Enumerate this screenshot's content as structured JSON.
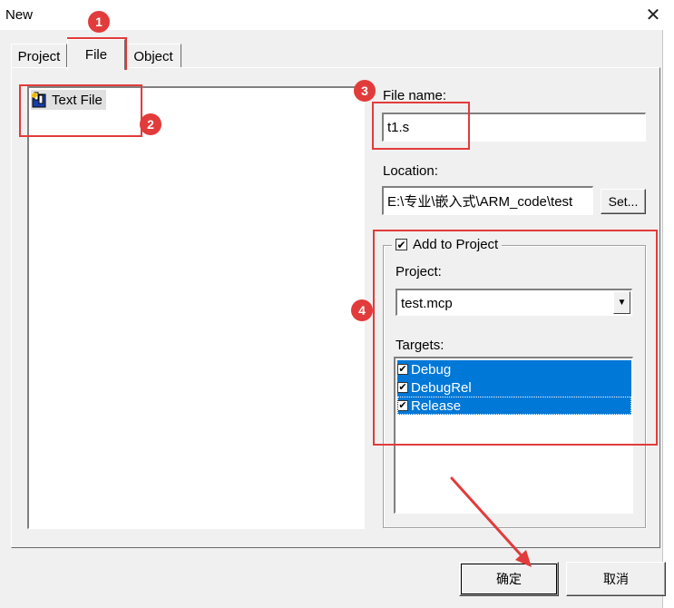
{
  "window": {
    "title": "New",
    "close_glyph": "✕"
  },
  "tabs": [
    {
      "label": "Project"
    },
    {
      "label": "File",
      "active": true
    },
    {
      "label": "Object"
    }
  ],
  "file_types": [
    {
      "label": "Text File",
      "icon": "text-file-icon"
    }
  ],
  "file_name": {
    "label": "File name:",
    "value": "t1.s"
  },
  "location": {
    "label": "Location:",
    "value": "E:\\专业\\嵌入式\\ARM_code\\test",
    "set_button": "Set..."
  },
  "add_to_project": {
    "label": "Add to Project",
    "checked": true,
    "project_label": "Project:",
    "project_value": "test.mcp",
    "targets_label": "Targets:",
    "targets": [
      {
        "label": "Debug",
        "checked": true
      },
      {
        "label": "DebugRel",
        "checked": true
      },
      {
        "label": "Release",
        "checked": true
      }
    ]
  },
  "buttons": {
    "ok": "确定",
    "cancel": "取消"
  },
  "annotations": [
    "1",
    "2",
    "3",
    "4"
  ],
  "colors": {
    "selection": "#0078d7",
    "annotation": "#e23b3b",
    "item_highlight": "#e0e0e0"
  }
}
